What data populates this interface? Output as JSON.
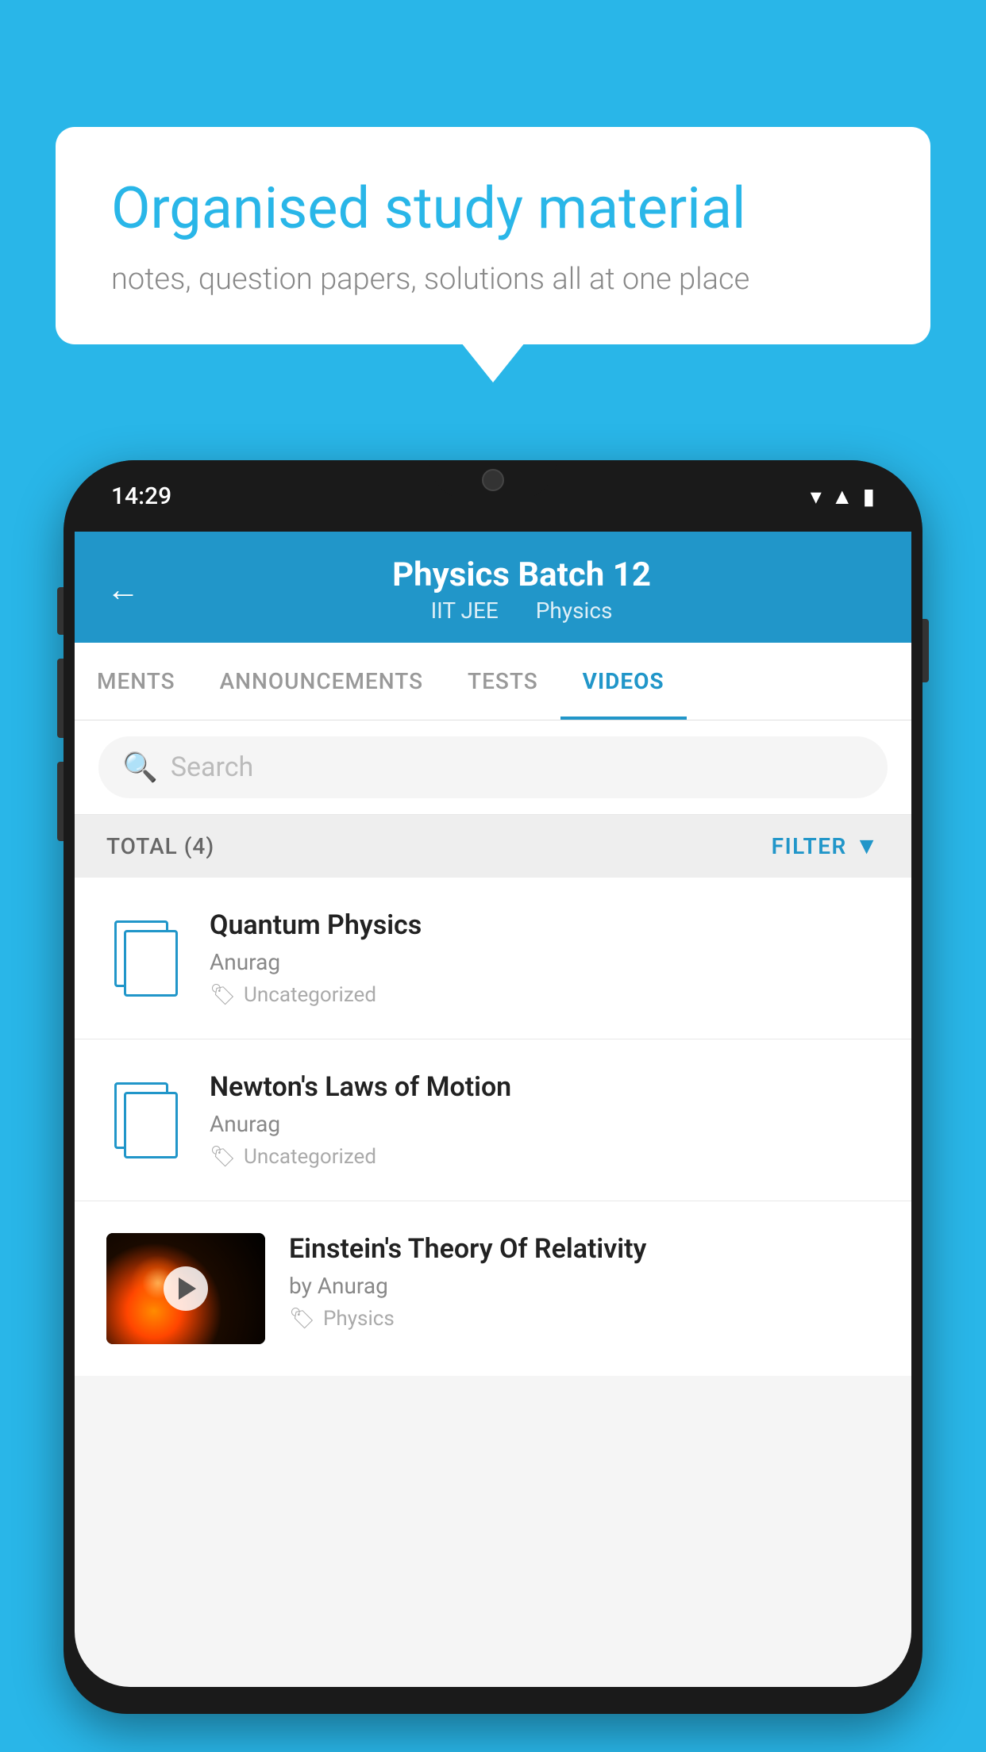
{
  "background": {
    "color": "#29B6E8"
  },
  "speechBubble": {
    "title": "Organised study material",
    "subtitle": "notes, question papers, solutions all at one place"
  },
  "phone": {
    "statusBar": {
      "time": "14:29"
    },
    "header": {
      "title": "Physics Batch 12",
      "subtitle1": "IIT JEE",
      "subtitle2": "Physics"
    },
    "tabs": [
      {
        "label": "MENTS",
        "active": false
      },
      {
        "label": "ANNOUNCEMENTS",
        "active": false
      },
      {
        "label": "TESTS",
        "active": false
      },
      {
        "label": "VIDEOS",
        "active": true
      }
    ],
    "search": {
      "placeholder": "Search"
    },
    "filterRow": {
      "totalLabel": "TOTAL (4)",
      "filterLabel": "FILTER"
    },
    "videoItems": [
      {
        "title": "Quantum Physics",
        "author": "Anurag",
        "tag": "Uncategorized",
        "hasThumb": false
      },
      {
        "title": "Newton's Laws of Motion",
        "author": "Anurag",
        "tag": "Uncategorized",
        "hasThumb": false
      },
      {
        "title": "Einstein's Theory Of Relativity",
        "author": "by Anurag",
        "tag": "Physics",
        "hasThumb": true
      }
    ]
  }
}
